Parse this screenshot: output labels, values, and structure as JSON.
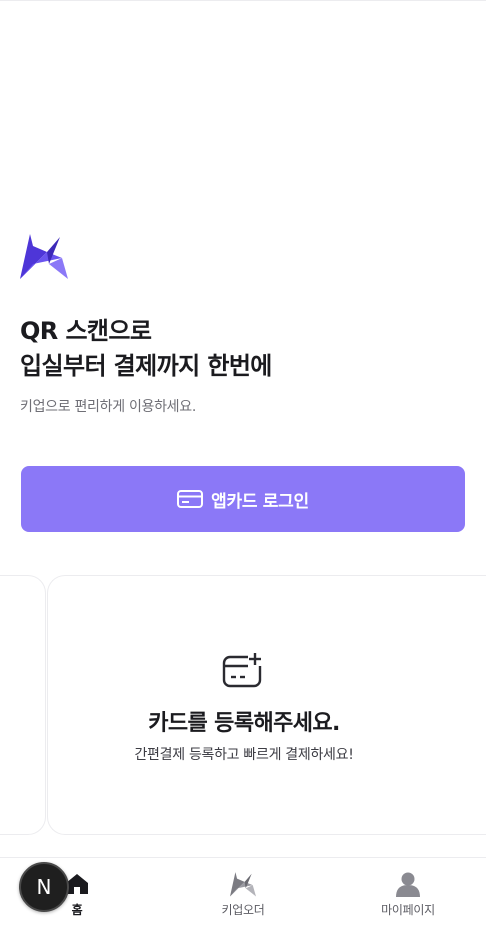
{
  "headline": {
    "line1": "QR 스캔으로",
    "line2": "입실부터 결제까지 한번에",
    "subtext": "키업으로 편리하게 이용하세요."
  },
  "login_button": {
    "label": "앱카드 로그인",
    "icon": "card-icon"
  },
  "card_panel": {
    "title": "카드를 등록해주세요.",
    "subtitle": "간편결제 등록하고 빠르게 결제하세요!",
    "icon": "add-card-icon"
  },
  "tabbar": {
    "items": [
      {
        "label": "홈",
        "icon": "home-icon",
        "active": true
      },
      {
        "label": "키업오더",
        "icon": "star-icon",
        "active": false
      },
      {
        "label": "마이페이지",
        "icon": "person-icon",
        "active": false
      }
    ]
  },
  "badge": {
    "letter": "N"
  },
  "colors": {
    "accent": "#8b78f7",
    "brand_purple": "#5b45e0",
    "text": "#1b1b1f",
    "muted": "#6f6f76"
  }
}
